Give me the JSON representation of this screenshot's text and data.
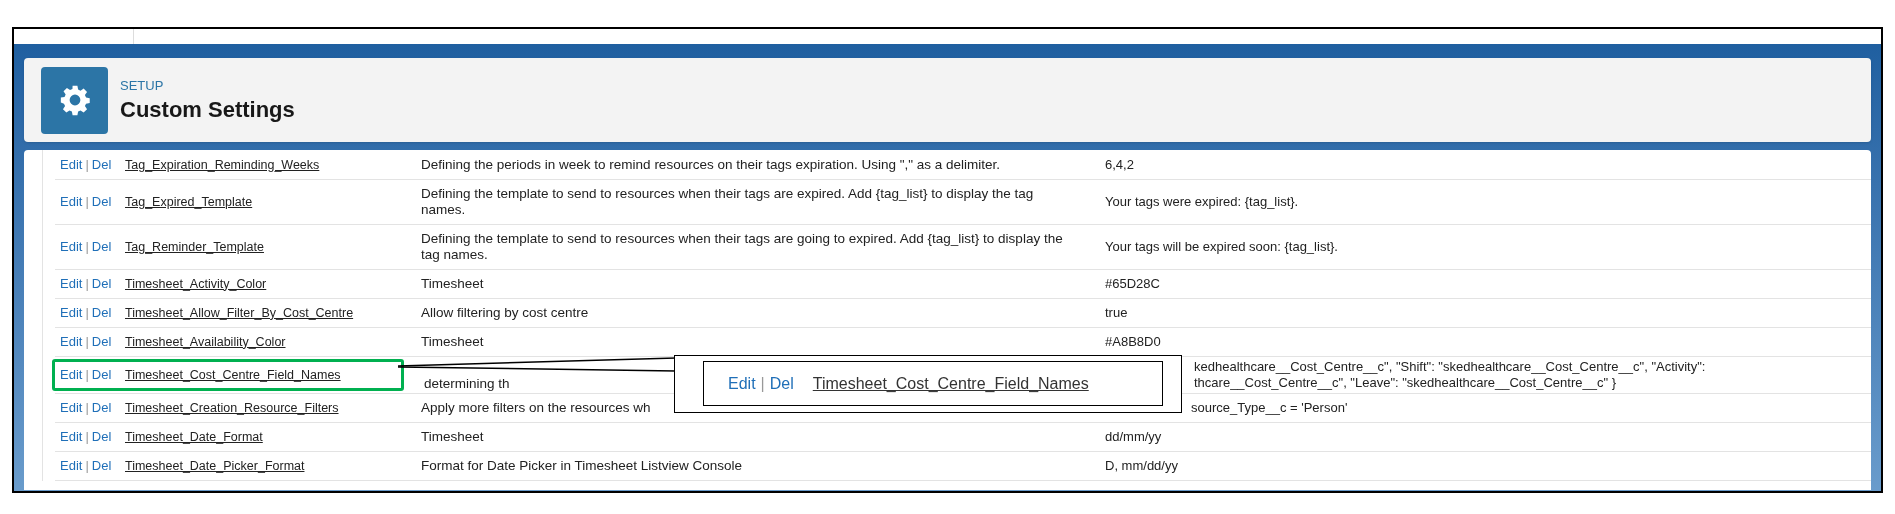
{
  "header": {
    "breadcrumb": "SETUP",
    "title": "Custom Settings"
  },
  "rows": [
    {
      "edit": "Edit",
      "separator": "|",
      "del": "Del",
      "name": "Tag_Expiration_Reminding_Weeks",
      "description": "Defining the periods in week to remind resources on their tags expiration. Using \",\" as a delimiter.",
      "value": "6,4,2",
      "highlighted": false,
      "covered": false
    },
    {
      "edit": "Edit",
      "separator": "|",
      "del": "Del",
      "name": "Tag_Expired_Template",
      "description": "Defining the template to send to resources when their tags are expired. Add {tag_list} to display the tag names.",
      "value": "Your tags were expired: {tag_list}.",
      "highlighted": false,
      "covered": false
    },
    {
      "edit": "Edit",
      "separator": "|",
      "del": "Del",
      "name": "Tag_Reminder_Template",
      "description": "Defining the template to send to resources when their tags are going to expired. Add {tag_list} to display the tag names.",
      "value": "Your tags will be expired soon: {tag_list}.",
      "highlighted": false,
      "covered": false
    },
    {
      "edit": "Edit",
      "separator": "|",
      "del": "Del",
      "name": "Timesheet_Activity_Color",
      "description": "Timesheet",
      "value": "#65D28C",
      "highlighted": false,
      "covered": false
    },
    {
      "edit": "Edit",
      "separator": "|",
      "del": "Del",
      "name": "Timesheet_Allow_Filter_By_Cost_Centre",
      "description": "Allow filtering by cost centre",
      "value": "true",
      "highlighted": false,
      "covered": false
    },
    {
      "edit": "Edit",
      "separator": "|",
      "del": "Del",
      "name": "Timesheet_Availability_Color",
      "description": "Timesheet",
      "value": "#A8B8D0",
      "highlighted": false,
      "covered": false
    },
    {
      "edit": "Edit",
      "separator": "|",
      "del": "Del",
      "name": "Timesheet_Cost_Centre_Field_Names",
      "description": "determining th",
      "value": "kedhealthcare__Cost_Centre__c\", \"Shift\": \"skedhealthcare__Cost_Centre__c\", \"Activity\": thcare__Cost_Centre__c\", \"Leave\": \"skedhealthcare__Cost_Centre__c\" }",
      "highlighted": true,
      "covered": true
    },
    {
      "edit": "Edit",
      "separator": "|",
      "del": "Del",
      "name": "Timesheet_Creation_Resource_Filters",
      "description": "Apply more filters on the resources wh",
      "value": "source_Type__c = 'Person'",
      "highlighted": false,
      "covered": true
    },
    {
      "edit": "Edit",
      "separator": "|",
      "del": "Del",
      "name": "Timesheet_Date_Format",
      "description": "Timesheet",
      "value": "dd/mm/yy",
      "highlighted": false,
      "covered": false
    },
    {
      "edit": "Edit",
      "separator": "|",
      "del": "Del",
      "name": "Timesheet_Date_Picker_Format",
      "description": "Format for Date Picker in Timesheet Listview Console",
      "value": "D, mm/dd/yy",
      "highlighted": false,
      "covered": false
    }
  ],
  "callout": {
    "edit": "Edit",
    "separator": "|",
    "del": "Del",
    "name": "Timesheet_Cost_Centre_Field_Names"
  }
}
